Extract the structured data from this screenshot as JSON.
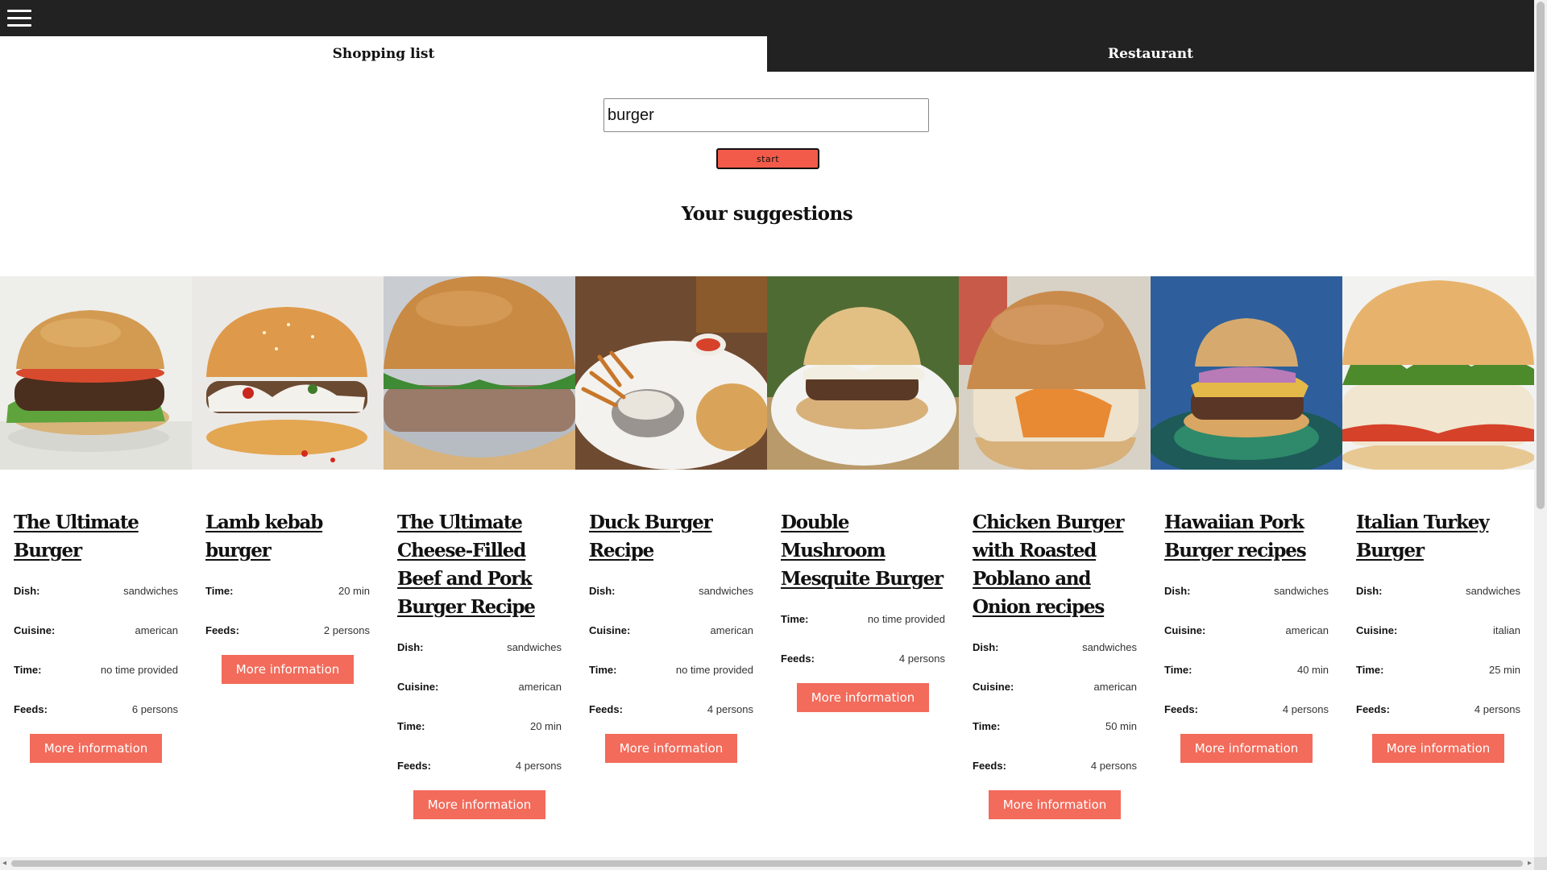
{
  "nav": {
    "menu_icon": "hamburger-menu-icon"
  },
  "tabs": [
    {
      "label": "Shopping list",
      "active": true
    },
    {
      "label": "Restaurant",
      "active": false
    }
  ],
  "search": {
    "value": "burger",
    "start_label": "start"
  },
  "suggestions_title": "Your suggestions",
  "colors": {
    "topbar": "#222222",
    "accent": "#f26b5b",
    "start": "#f25a4a"
  },
  "cards": [
    {
      "title": "The Ultimate Burger",
      "rows": [
        {
          "label": "Dish:",
          "value": "sandwiches"
        },
        {
          "label": "Cuisine:",
          "value": "american"
        },
        {
          "label": "Time:",
          "value": "no time provided"
        },
        {
          "label": "Feeds:",
          "value": "6 persons"
        }
      ],
      "button": "More information"
    },
    {
      "title": "Lamb kebab burger",
      "rows": [
        {
          "label": "Time:",
          "value": "20 min"
        },
        {
          "label": "Feeds:",
          "value": "2 persons"
        }
      ],
      "button": "More information"
    },
    {
      "title": "The Ultimate Cheese-Filled Beef and Pork Burger Recipe",
      "rows": [
        {
          "label": "Dish:",
          "value": "sandwiches"
        },
        {
          "label": "Cuisine:",
          "value": "american"
        },
        {
          "label": "Time:",
          "value": "20 min"
        },
        {
          "label": "Feeds:",
          "value": "4 persons"
        }
      ],
      "button": "More information"
    },
    {
      "title": "Duck Burger Recipe",
      "rows": [
        {
          "label": "Dish:",
          "value": "sandwiches"
        },
        {
          "label": "Cuisine:",
          "value": "american"
        },
        {
          "label": "Time:",
          "value": "no time provided"
        },
        {
          "label": "Feeds:",
          "value": "4 persons"
        }
      ],
      "button": "More information"
    },
    {
      "title": "Double Mushroom Mesquite Burger",
      "rows": [
        {
          "label": "Time:",
          "value": "no time provided"
        },
        {
          "label": "Feeds:",
          "value": "4 persons"
        }
      ],
      "button": "More information"
    },
    {
      "title": "Chicken Burger with Roasted Poblano and Onion recipes",
      "rows": [
        {
          "label": "Dish:",
          "value": "sandwiches"
        },
        {
          "label": "Cuisine:",
          "value": "american"
        },
        {
          "label": "Time:",
          "value": "50 min"
        },
        {
          "label": "Feeds:",
          "value": "4 persons"
        }
      ],
      "button": "More information"
    },
    {
      "title": "Hawaiian Pork Burger recipes",
      "rows": [
        {
          "label": "Dish:",
          "value": "sandwiches"
        },
        {
          "label": "Cuisine:",
          "value": "american"
        },
        {
          "label": "Time:",
          "value": "40 min"
        },
        {
          "label": "Feeds:",
          "value": "4 persons"
        }
      ],
      "button": "More information"
    },
    {
      "title": "Italian Turkey Burger",
      "rows": [
        {
          "label": "Dish:",
          "value": "sandwiches"
        },
        {
          "label": "Cuisine:",
          "value": "italian"
        },
        {
          "label": "Time:",
          "value": "25 min"
        },
        {
          "label": "Feeds:",
          "value": "4 persons"
        }
      ],
      "button": "More information"
    }
  ]
}
